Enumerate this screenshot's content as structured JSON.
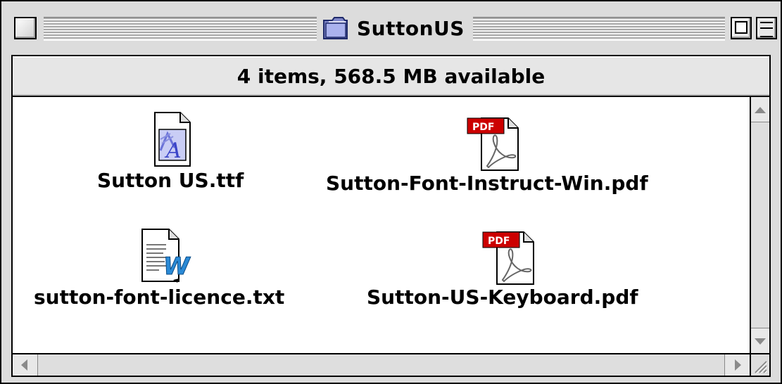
{
  "window": {
    "title": "SuttonUS"
  },
  "header": {
    "status_text": "4 items, 568.5 MB available"
  },
  "items": [
    {
      "label": "Sutton US.ttf",
      "icon": "font-file-icon"
    },
    {
      "label": "Sutton-Font-Instruct-Win.pdf",
      "icon": "pdf-file-icon",
      "badge": "PDF"
    },
    {
      "label": "sutton-font-licence.txt",
      "icon": "word-text-file-icon",
      "badge": "W"
    },
    {
      "label": "Sutton-US-Keyboard.pdf",
      "icon": "pdf-file-icon",
      "badge": "PDF"
    }
  ],
  "colors": {
    "pdf_badge": "#cc0000",
    "font_icon": "#4a5bd6",
    "word_w": "#2a8ad6"
  }
}
